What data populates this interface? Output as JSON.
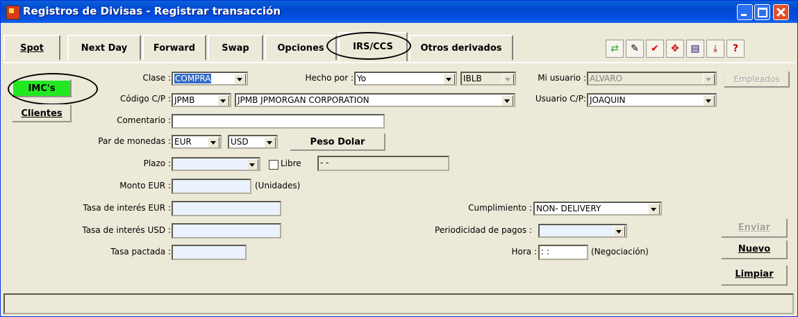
{
  "window": {
    "title": "Registros de Divisas - Registrar transacción"
  },
  "tabs": [
    {
      "label": "Spot"
    },
    {
      "label": "Next Day"
    },
    {
      "label": "Forward"
    },
    {
      "label": "Swap"
    },
    {
      "label": "Opciones"
    },
    {
      "label": "IRS/CCS"
    },
    {
      "label": "Otros derivados"
    }
  ],
  "toolbar": {
    "icons": [
      "currency-swap-icon",
      "note-icon",
      "check-person-icon",
      "move-cross-icon",
      "document-icon",
      "export-icon",
      "help-icon"
    ]
  },
  "left_buttons": {
    "imcs": "IMC's",
    "clientes": "Clientes"
  },
  "form": {
    "clase_label": "Clase :",
    "clase_value": "COMPRA",
    "hecho_por_label": "Hecho por :",
    "hecho_por_value": "Yo",
    "hecho_por_code": "IBLB",
    "mi_usuario_label": "Mi usuario :",
    "mi_usuario_value": "ALVARO",
    "empleados_button": "Empleados",
    "codigo_cp_label": "Código C/P :",
    "codigo_cp_value": "JPMB",
    "codigo_cp_name": "JPMB  JPMORGAN CORPORATION",
    "usuario_cp_label": "Usuario C/P:",
    "usuario_cp_value": "JOAQUIN",
    "comentario_label": "Comentario :",
    "comentario_value": "",
    "par_monedas_label": "Par de monedas :",
    "moneda1": "EUR",
    "moneda2": "USD",
    "peso_dolar_button": "Peso Dolar",
    "plazo_label": "Plazo :",
    "plazo_value": "",
    "libre_label": "Libre",
    "libre_value": "-  -",
    "monto_label": "Monto EUR :",
    "monto_value": "",
    "monto_unit": "(Unidades)",
    "tasa_eur_label": "Tasa de interés EUR :",
    "tasa_eur_value": "",
    "tasa_usd_label": "Tasa de interés USD :",
    "tasa_usd_value": "",
    "tasa_pactada_label": "Tasa pactada :",
    "tasa_pactada_value": "",
    "cumplimiento_label": "Cumplimiento :",
    "cumplimiento_value": "NON- DELIVERY",
    "periodicidad_label": "Periodicidad de pagos :",
    "periodicidad_value": "",
    "hora_label": "Hora :",
    "hora_value": " :  :",
    "hora_note": "(Negociación)"
  },
  "actions": {
    "enviar": "Enviar",
    "nuevo": "Nuevo",
    "limpiar": "Limpiar"
  },
  "colors": {
    "titlebar": "#0048d0",
    "imcs_button": "#22e822",
    "selected": "#316ac5",
    "input_blue": "#eaf2fd"
  }
}
